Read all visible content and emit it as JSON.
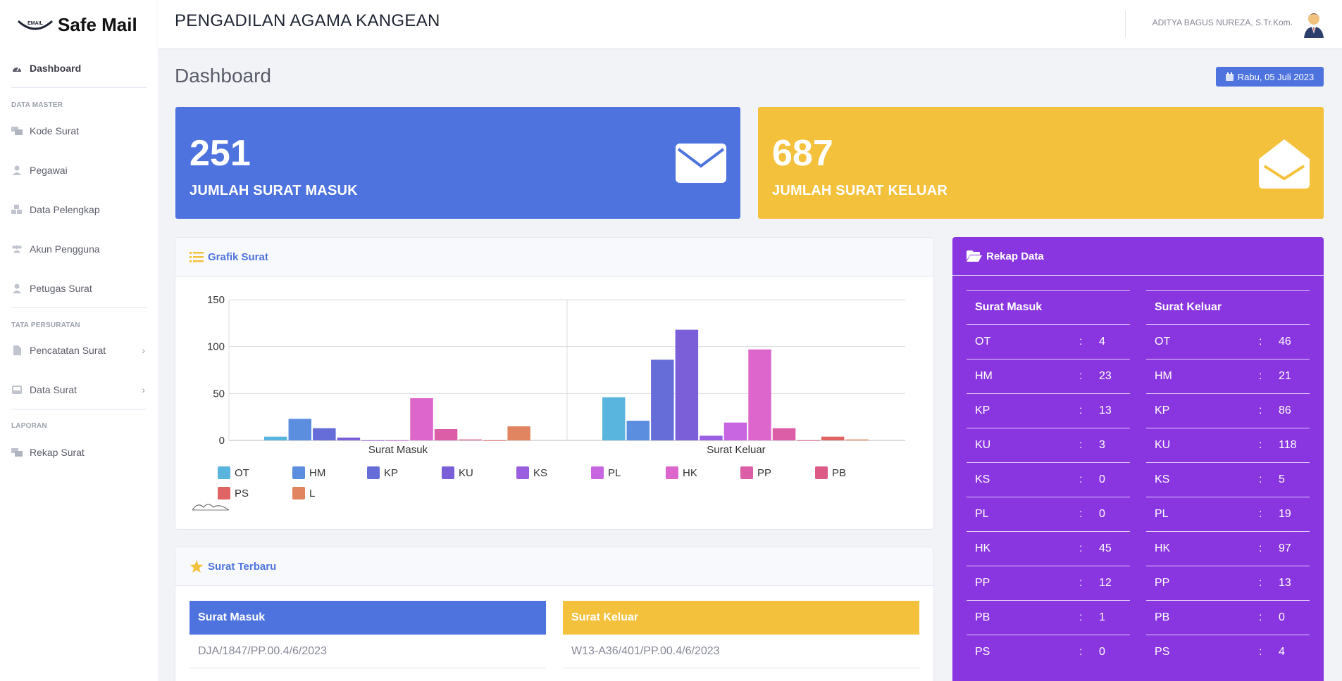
{
  "app": {
    "name": "Safe Mail",
    "logo_small": "EMAIL"
  },
  "header": {
    "title": "PENGADILAN AGAMA KANGEAN",
    "user": "ADITYA BAGUS NUREZA, S.Tr.Kom."
  },
  "sidebar": {
    "dashboard": "Dashboard",
    "section_master": "DATA MASTER",
    "kode_surat": "Kode Surat",
    "pegawai": "Pegawai",
    "data_pelengkap": "Data Pelengkap",
    "akun_pengguna": "Akun Pengguna",
    "petugas_surat": "Petugas Surat",
    "section_persuratan": "TATA PERSURATAN",
    "pencatatan_surat": "Pencatatan Surat",
    "data_surat": "Data Surat",
    "section_laporan": "LAPORAN",
    "rekap_surat": "Rekap Surat"
  },
  "page": {
    "title": "Dashboard",
    "date": "Rabu, 05 Juli 2023"
  },
  "stats": {
    "masuk": {
      "value": "251",
      "label": "JUMLAH SURAT MASUK",
      "color": "#4e73df"
    },
    "keluar": {
      "value": "687",
      "label": "JUMLAH SURAT KELUAR",
      "color": "#f4c13c"
    }
  },
  "grafik": {
    "title": "Grafik Surat"
  },
  "chart_data": {
    "type": "bar",
    "categories": [
      "Surat Masuk",
      "Surat Keluar"
    ],
    "ylim": [
      0,
      150
    ],
    "yticks": [
      0,
      50,
      100,
      150
    ],
    "series": [
      {
        "name": "OT",
        "color": "#5ab5de",
        "values": [
          4,
          46
        ]
      },
      {
        "name": "HM",
        "color": "#5b8edf",
        "values": [
          23,
          21
        ]
      },
      {
        "name": "KP",
        "color": "#666dd9",
        "values": [
          13,
          86
        ]
      },
      {
        "name": "KU",
        "color": "#7a5fd9",
        "values": [
          3,
          118
        ]
      },
      {
        "name": "KS",
        "color": "#9a5fe0",
        "values": [
          0,
          5
        ]
      },
      {
        "name": "PL",
        "color": "#c766e0",
        "values": [
          0,
          19
        ]
      },
      {
        "name": "HK",
        "color": "#dd66cc",
        "values": [
          45,
          97
        ]
      },
      {
        "name": "PP",
        "color": "#dc5ea6",
        "values": [
          12,
          13
        ]
      },
      {
        "name": "PB",
        "color": "#dc5a85",
        "values": [
          1,
          0
        ]
      },
      {
        "name": "PS",
        "color": "#e06464",
        "values": [
          0,
          4
        ]
      },
      {
        "name": "L",
        "color": "#e0855f",
        "values": [
          15,
          1
        ]
      }
    ]
  },
  "rekap": {
    "title": "Rekap Data",
    "masuk_header": "Surat Masuk",
    "keluar_header": "Surat Keluar",
    "sep": ":",
    "masuk": [
      {
        "k": "OT",
        "v": "4"
      },
      {
        "k": "HM",
        "v": "23"
      },
      {
        "k": "KP",
        "v": "13"
      },
      {
        "k": "KU",
        "v": "3"
      },
      {
        "k": "KS",
        "v": "0"
      },
      {
        "k": "PL",
        "v": "0"
      },
      {
        "k": "HK",
        "v": "45"
      },
      {
        "k": "PP",
        "v": "12"
      },
      {
        "k": "PB",
        "v": "1"
      },
      {
        "k": "PS",
        "v": "0"
      }
    ],
    "keluar": [
      {
        "k": "OT",
        "v": "46"
      },
      {
        "k": "HM",
        "v": "21"
      },
      {
        "k": "KP",
        "v": "86"
      },
      {
        "k": "KU",
        "v": "118"
      },
      {
        "k": "KS",
        "v": "5"
      },
      {
        "k": "PL",
        "v": "19"
      },
      {
        "k": "HK",
        "v": "97"
      },
      {
        "k": "PP",
        "v": "13"
      },
      {
        "k": "PB",
        "v": "0"
      },
      {
        "k": "PS",
        "v": "4"
      }
    ]
  },
  "terbaru": {
    "title": "Surat Terbaru",
    "masuk_header": "Surat Masuk",
    "keluar_header": "Surat Keluar",
    "masuk_first": "DJA/1847/PP.00.4/6/2023",
    "keluar_first": "W13-A36/401/PP.00.4/6/2023"
  }
}
